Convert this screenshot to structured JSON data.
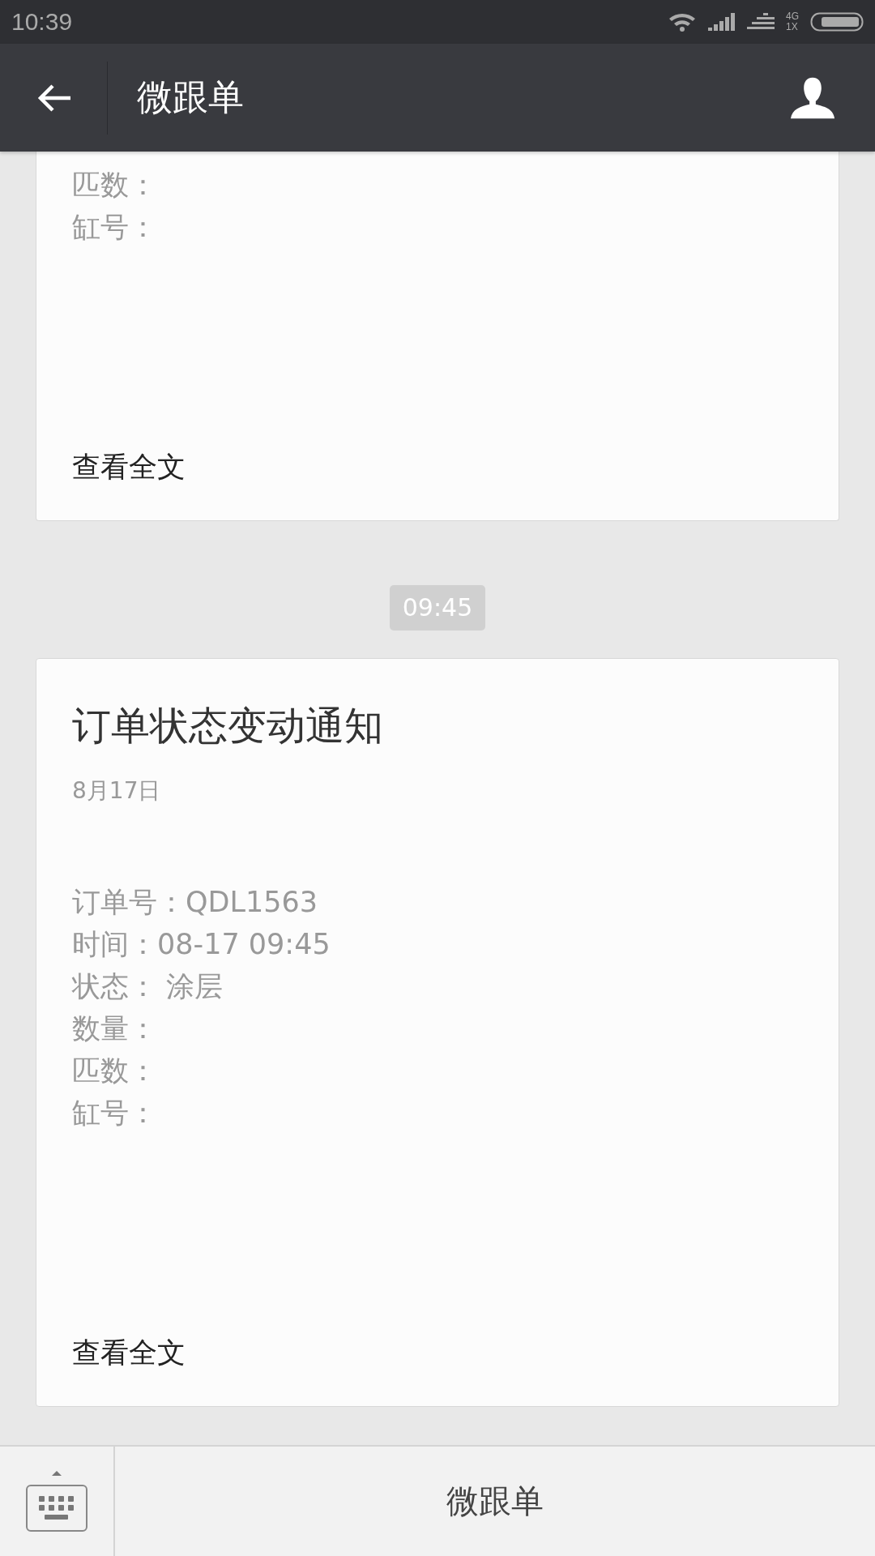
{
  "status_bar": {
    "time": "10:39",
    "network": "4G",
    "sim": "1X"
  },
  "header": {
    "title": "微跟单"
  },
  "messages": [
    {
      "kind": "card",
      "lines": [
        "匹数：",
        "缸号："
      ],
      "link": "查看全文"
    },
    {
      "kind": "time",
      "text": "09:45"
    },
    {
      "kind": "card",
      "title": "订单状态变动通知",
      "date": "8月17日",
      "lines": [
        "订单号：QDL1563",
        "时间：08-17 09:45",
        "状态： 涂层",
        "数量：",
        "匹数：",
        "缸号："
      ],
      "link": "查看全文"
    }
  ],
  "bottom_bar": {
    "menu": [
      "微跟单"
    ]
  }
}
